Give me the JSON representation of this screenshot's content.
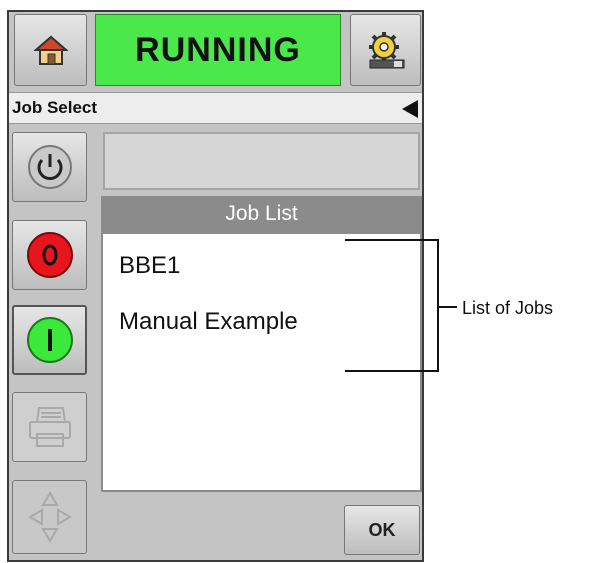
{
  "status_bar": {
    "status": "RUNNING",
    "status_color": "#4be84b"
  },
  "screen": {
    "title": "Job Select"
  },
  "job_list": {
    "header": "Job List",
    "items": [
      "BBE1",
      "Manual Example"
    ]
  },
  "buttons": {
    "ok_label": "OK"
  },
  "callout": {
    "label": "List of Jobs"
  },
  "icons": [
    "home-icon",
    "settings-gear-icon",
    "back-arrow-icon",
    "power-icon",
    "stop-icon",
    "start-icon",
    "printer-icon",
    "navigation-arrows-icon"
  ]
}
